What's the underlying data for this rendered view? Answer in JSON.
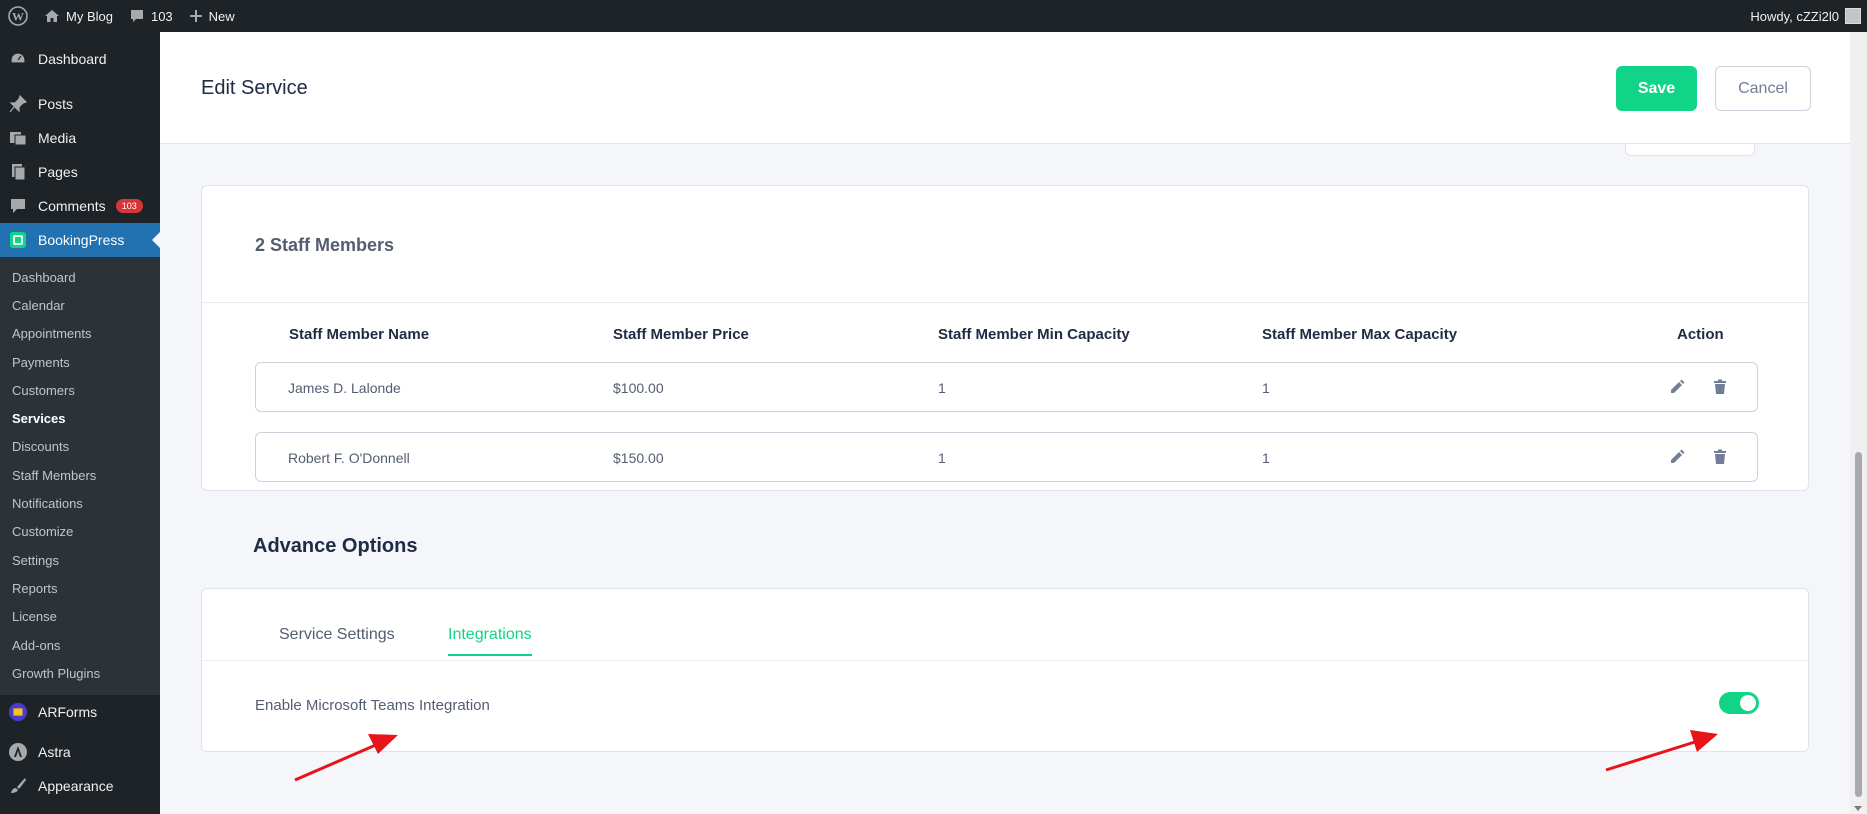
{
  "admin_bar": {
    "site_name": "My Blog",
    "comments_count": "103",
    "new_label": "New",
    "howdy": "Howdy, cZZi2l0"
  },
  "sidebar": {
    "top_items": [
      {
        "label": "Dashboard",
        "icon": "dashboard-icon"
      },
      {
        "label": "Posts",
        "icon": "pin-icon"
      },
      {
        "label": "Media",
        "icon": "media-icon"
      },
      {
        "label": "Pages",
        "icon": "pages-icon"
      },
      {
        "label": "Comments",
        "icon": "comment-icon",
        "badge": "103"
      }
    ],
    "current": {
      "label": "BookingPress",
      "icon": "bookingpress-icon"
    },
    "submenu": [
      "Dashboard",
      "Calendar",
      "Appointments",
      "Payments",
      "Customers",
      "Services",
      "Discounts",
      "Staff Members",
      "Notifications",
      "Customize",
      "Settings",
      "Reports",
      "License",
      "Add-ons",
      "Growth Plugins"
    ],
    "active_submenu": "Services",
    "bottom_items": [
      {
        "label": "ARForms",
        "icon": "arforms-icon"
      },
      {
        "label": "Astra",
        "icon": "astra-icon"
      },
      {
        "label": "Appearance",
        "icon": "brush-icon"
      }
    ]
  },
  "header": {
    "title": "Edit Service",
    "save_label": "Save",
    "cancel_label": "Cancel"
  },
  "staff": {
    "title": "2 Staff Members",
    "columns": [
      "Staff Member Name",
      "Staff Member Price",
      "Staff Member Min Capacity",
      "Staff Member Max Capacity",
      "Action"
    ],
    "rows": [
      {
        "name": "James D. Lalonde",
        "price": "$100.00",
        "min": "1",
        "max": "1"
      },
      {
        "name": "Robert F. O'Donnell",
        "price": "$150.00",
        "min": "1",
        "max": "1"
      }
    ]
  },
  "advance": {
    "title": "Advance Options",
    "tabs": [
      "Service Settings",
      "Integrations"
    ],
    "active_tab": "Integrations",
    "toggle_label": "Enable Microsoft Teams Integration",
    "toggle_on": true
  },
  "colors": {
    "accent": "#12d488",
    "admin_dark": "#1d2327",
    "current_menu": "#2271b1",
    "annotation_arrow": "#e8141a"
  }
}
